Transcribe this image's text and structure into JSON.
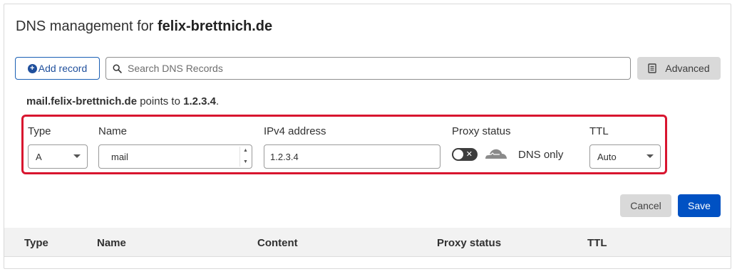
{
  "header": {
    "title_prefix": "DNS management for",
    "domain": "felix-brettnich.de"
  },
  "toolbar": {
    "add_record_label": "Add record",
    "search_placeholder": "Search DNS Records",
    "advanced_label": "Advanced"
  },
  "summary": {
    "host": "mail.felix-brettnich.de",
    "middle": "points to",
    "target": "1.2.3.4",
    "end": "."
  },
  "edit_row": {
    "type_label": "Type",
    "type_value": "A",
    "name_label": "Name",
    "name_value": "mail",
    "ipv4_label": "IPv4 address",
    "ipv4_value": "1.2.3.4",
    "proxy_label": "Proxy status",
    "proxy_state": "off",
    "proxy_value": "DNS only",
    "ttl_label": "TTL",
    "ttl_value": "Auto"
  },
  "actions": {
    "cancel_label": "Cancel",
    "save_label": "Save"
  },
  "table": {
    "columns": [
      "Type",
      "Name",
      "Content",
      "Proxy status",
      "TTL"
    ]
  },
  "colors": {
    "accent_blue": "#0051c3",
    "highlight_red": "#d8152f",
    "button_gray": "#d9d9d9"
  }
}
